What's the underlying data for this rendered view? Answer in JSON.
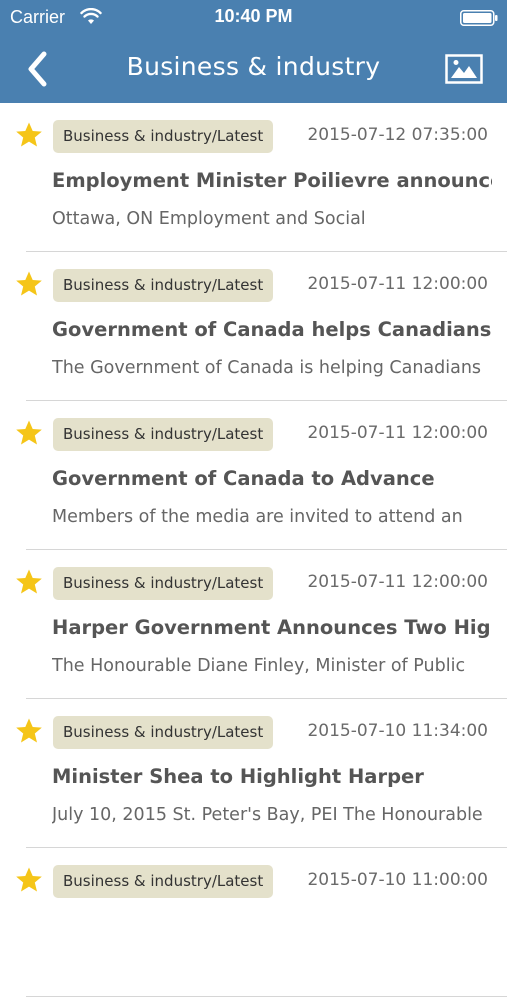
{
  "status_bar": {
    "carrier": "Carrier",
    "time": "10:40 PM",
    "icons": [
      "wifi-icon",
      "battery-icon"
    ]
  },
  "nav": {
    "title": "Business & industry",
    "back_icon": "chevron-left-icon",
    "image_icon": "image-icon",
    "background_color": "#4a80b0"
  },
  "items": [
    {
      "tag": "Business & industry/Latest",
      "date": "2015-07-12 07:35:00",
      "title": "Employment Minister Poilievre announces",
      "summary": "Ottawa, ON  Employment and Social"
    },
    {
      "tag": "Business & industry/Latest",
      "date": "2015-07-11 12:00:00",
      "title": "Government of Canada helps Canadians",
      "summary": "The Government of Canada is helping Canadians"
    },
    {
      "tag": "Business & industry/Latest",
      "date": "2015-07-11 12:00:00",
      "title": "Government of Canada to Advance",
      "summary": "Members of the media are invited to attend an"
    },
    {
      "tag": "Business & industry/Latest",
      "date": "2015-07-11 12:00:00",
      "title": "Harper Government Announces Two High-",
      "summary": "The Honourable Diane Finley, Minister of Public"
    },
    {
      "tag": "Business & industry/Latest",
      "date": "2015-07-10 11:34:00",
      "title": "Minister Shea to Highlight Harper",
      "summary": "July 10, 2015 St. Peter's Bay, PEI  The Honourable"
    },
    {
      "tag": "Business & industry/Latest",
      "date": "2015-07-10 11:00:00",
      "title": "",
      "summary": ""
    }
  ],
  "colors": {
    "star": "#f5c518",
    "tag_background": "#e4e1cb"
  }
}
